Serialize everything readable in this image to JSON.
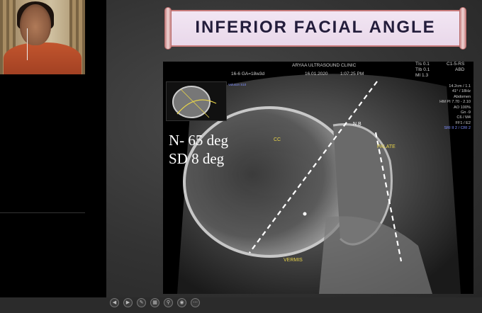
{
  "slide": {
    "title": "INFERIOR FACIAL ANGLE",
    "overlay": {
      "line1": "N- 65 deg",
      "line2": "SD 8 deg"
    }
  },
  "ultrasound": {
    "clinic": "ARYAA ULTRASOUND CLINIC",
    "ga": "16-6  GA=18w3d",
    "date": "16.01.2020",
    "time": "1:07:25 PM",
    "tis": "TIs  0.1",
    "tib": "TIb  0.1",
    "mi": "MI   1.3",
    "probe": "C1-5-RS",
    "mode": "ABD",
    "side_params": [
      "14.2cm / 1.1",
      "41° / 18Hz",
      "Abdomen",
      "HM PI 7.70 - 2.10",
      "AO 100%",
      "Gn  -9",
      "C6 / M4",
      "FF1 / E2"
    ],
    "side_blue": "SRI II 2 / CRI 2",
    "labels": {
      "cc": "CC",
      "nb": "N B",
      "palate": "PALATE",
      "vermis": "VERMIS"
    },
    "thumb_label": "Voluson S10"
  },
  "colors": {
    "banner_text": "#231d3b",
    "label_yellow": "#e8d44a",
    "scroll_border": "#c97b7b"
  }
}
